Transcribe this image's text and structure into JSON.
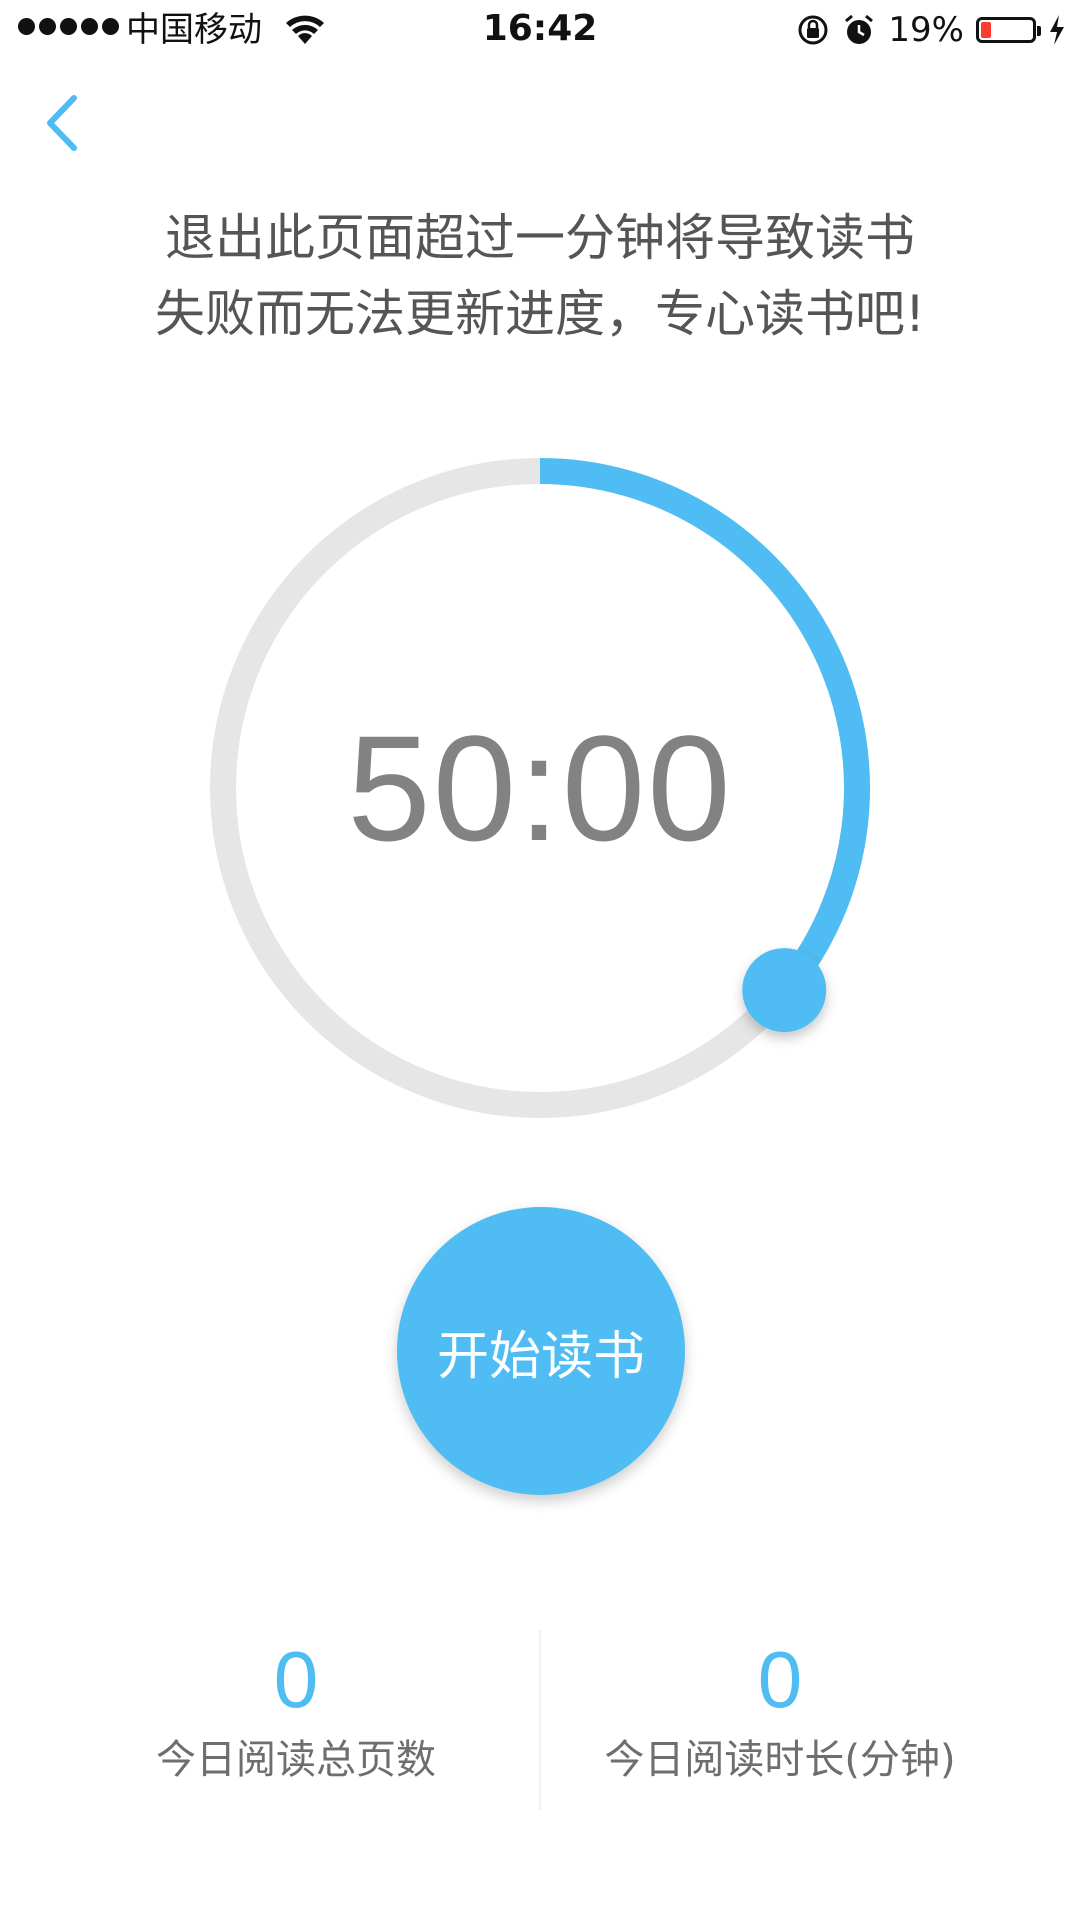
{
  "status_bar": {
    "carrier": "中国移动",
    "time": "16:42",
    "battery_percent": "19%",
    "battery_level": 0.19,
    "icons": [
      "signal-dots",
      "wifi-icon",
      "rotation-lock-icon",
      "alarm-icon",
      "battery-icon",
      "charging-icon"
    ]
  },
  "nav": {
    "back_icon": "chevron-left-icon"
  },
  "notice": {
    "line1": "退出此页面超过一分钟将导致读书",
    "line2": "失败而无法更新进度，专心读书吧!"
  },
  "timer": {
    "display": "50:00",
    "progress_fraction": 0.36,
    "colors": {
      "track": "#e6e6e6",
      "progress": "#4fbdf3",
      "knob": "#4fbdf3"
    }
  },
  "start_button": {
    "label": "开始读书",
    "color": "#4fbdf3"
  },
  "stats": {
    "pages_value": "0",
    "pages_label": "今日阅读总页数",
    "minutes_value": "0",
    "minutes_label": "今日阅读时长(分钟)"
  }
}
